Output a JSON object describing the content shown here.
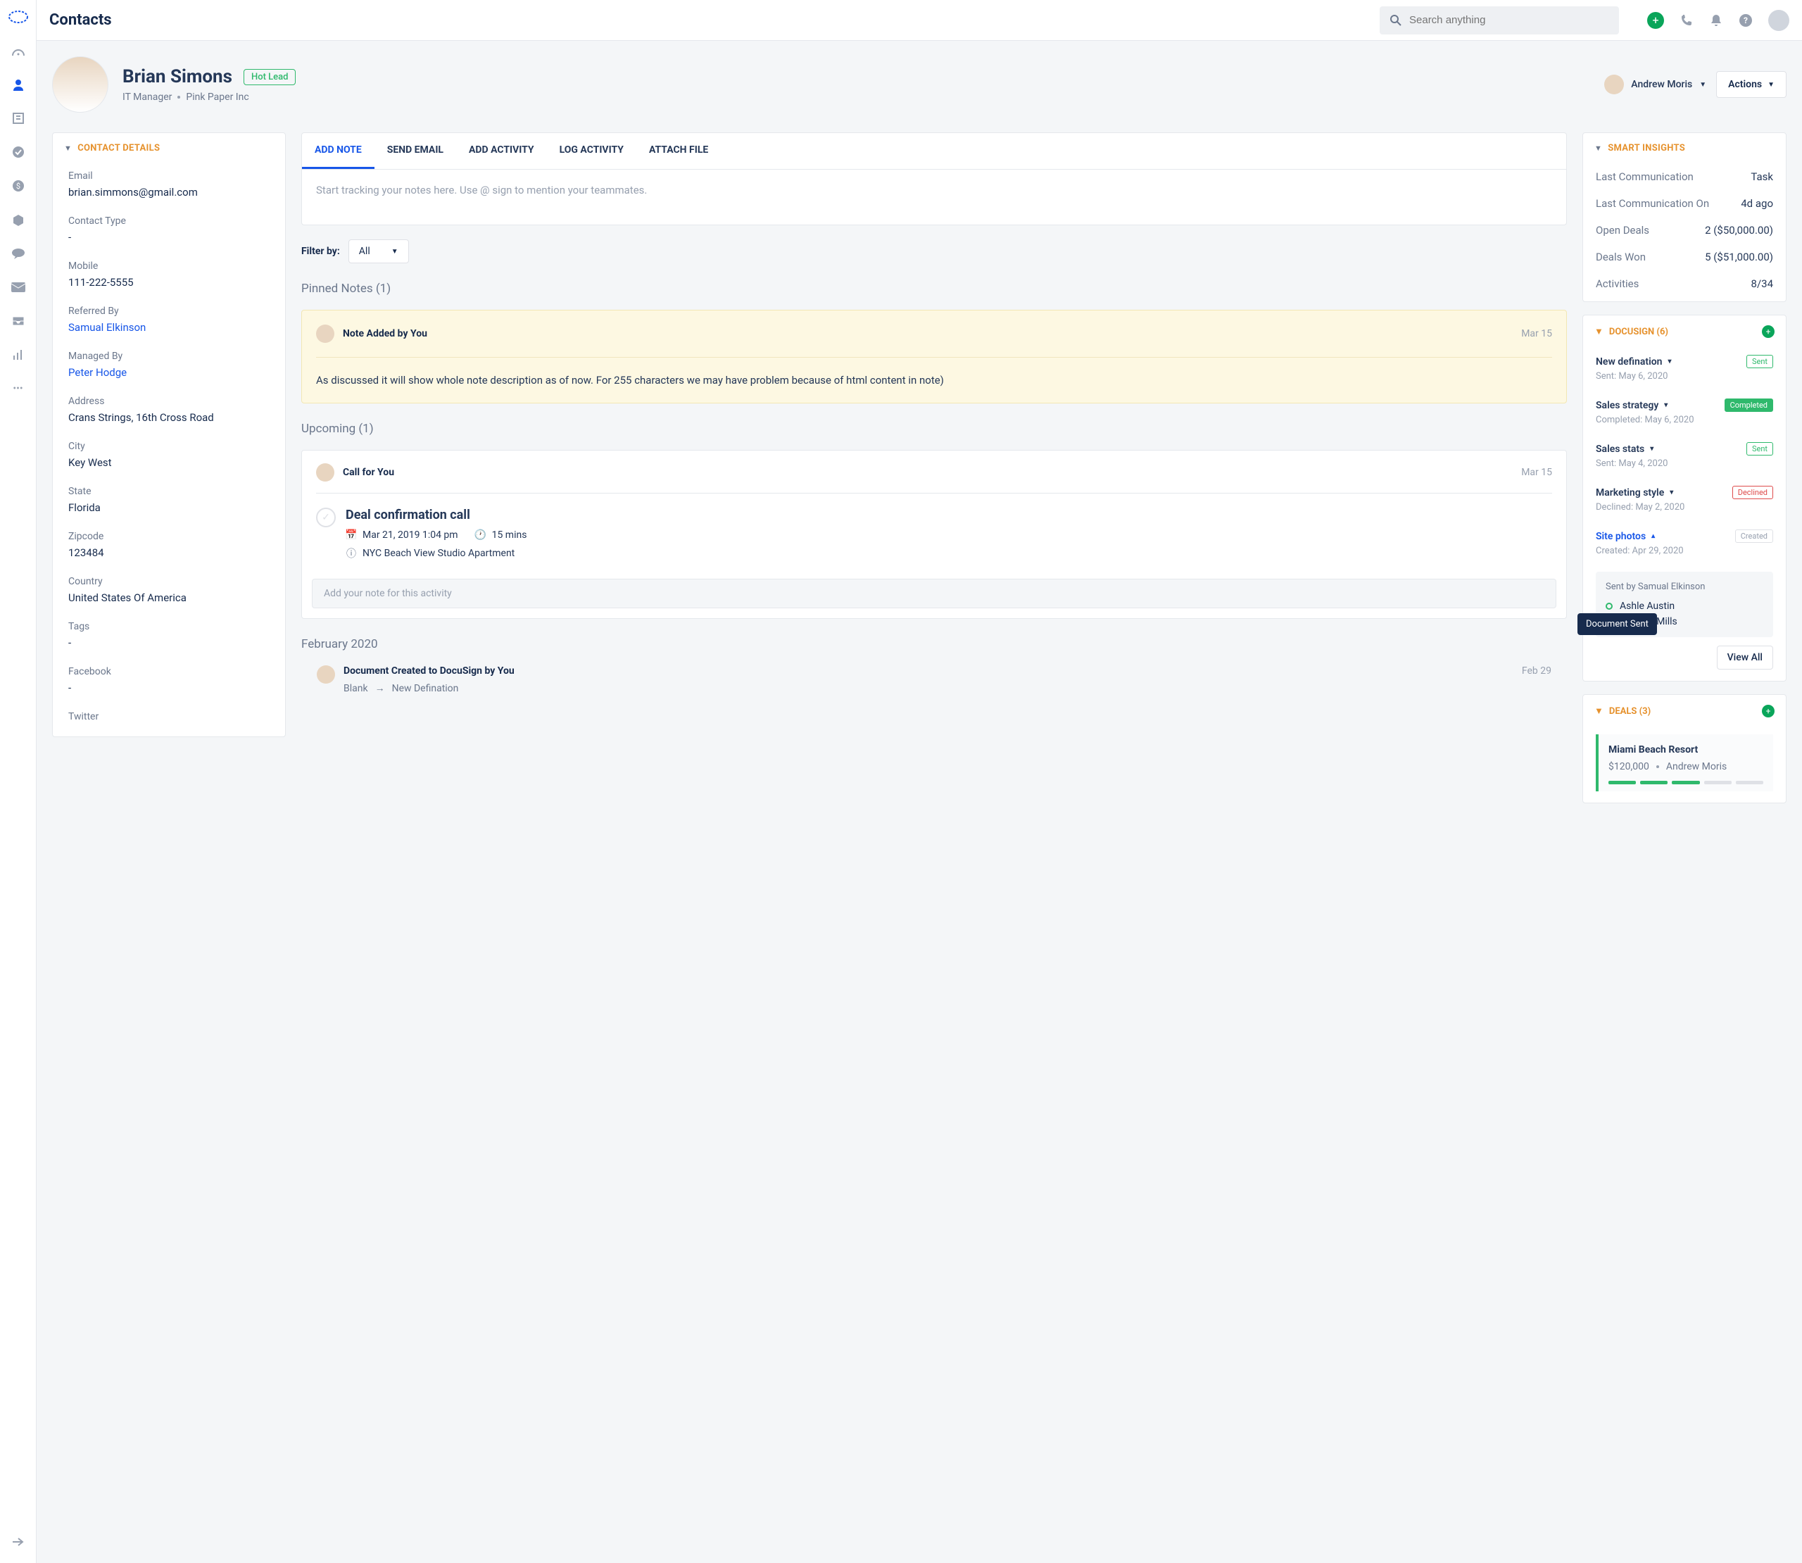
{
  "page_title": "Contacts",
  "search_placeholder": "Search anything",
  "contact": {
    "name": "Brian Simons",
    "badge": "Hot Lead",
    "role": "IT Manager",
    "company": "Pink Paper Inc"
  },
  "owner": {
    "name": "Andrew Moris"
  },
  "actions_label": "Actions",
  "details": {
    "title": "CONTACT DETAILS",
    "email_label": "Email",
    "email": "brian.simmons@gmail.com",
    "contact_type_label": "Contact Type",
    "contact_type": "-",
    "mobile_label": "Mobile",
    "mobile": "111-222-5555",
    "referred_label": "Referred By",
    "referred": "Samual Elkinson",
    "managed_label": "Managed By",
    "managed": "Peter Hodge",
    "address_label": "Address",
    "address": "Crans Strings, 16th Cross Road",
    "city_label": "City",
    "city": "Key West",
    "state_label": "State",
    "state": "Florida",
    "zip_label": "Zipcode",
    "zip": "123484",
    "country_label": "Country",
    "country": "United States Of America",
    "tags_label": "Tags",
    "tags": "-",
    "fb_label": "Facebook",
    "fb": "-",
    "tw_label": "Twitter"
  },
  "tabs": {
    "add_note": "ADD NOTE",
    "send_email": "SEND EMAIL",
    "add_activity": "ADD ACTIVITY",
    "log_activity": "LOG ACTIVITY",
    "attach_file": "ATTACH FILE"
  },
  "note_placeholder": "Start tracking your notes here. Use @ sign to mention your teammates.",
  "filter_label": "Filter by:",
  "filter_value": "All",
  "pinned_title": "Pinned Notes (1)",
  "pinned": {
    "title": "Note Added",
    "by": " by You",
    "date": "Mar 15",
    "body": "As discussed it will show whole note description as of now. For 255 characters we may have problem because of html content in note)"
  },
  "upcoming_title": "Upcoming (1)",
  "call": {
    "head": "Call",
    "by": " for You",
    "date": "Mar 15",
    "title": "Deal confirmation call",
    "datetime": "Mar 21, 2019 1:04 pm",
    "duration": "15 mins",
    "location": "NYC Beach View Studio Apartment",
    "add_note": "Add your note for this activity"
  },
  "feb_title": "February 2020",
  "feb_event": {
    "title": "Document Created to DocuSign",
    "by": " by You",
    "date": "Feb 29",
    "from": "Blank",
    "to": "New Defination"
  },
  "insights": {
    "title": "SMART INSIGHTS",
    "last_comm_k": "Last Communication",
    "last_comm_v": "Task",
    "last_comm_on_k": "Last Communication On",
    "last_comm_on_v": "4d ago",
    "open_deals_k": "Open Deals",
    "open_deals_v": "2 ($50,000.00)",
    "deals_won_k": "Deals Won",
    "deals_won_v": "5 ($51,000.00)",
    "activities_k": "Activities",
    "activities_v": "8/34"
  },
  "docusign": {
    "title": "DOCUSIGN (6)",
    "items": [
      {
        "name": "New defination",
        "sub": "Sent: May 6, 2020",
        "badge": "Sent",
        "cls": "b-sent"
      },
      {
        "name": "Sales strategy",
        "sub": "Completed: May 6, 2020",
        "badge": "Completed",
        "cls": "b-completed"
      },
      {
        "name": "Sales stats",
        "sub": "Sent: May 4, 2020",
        "badge": "Sent",
        "cls": "b-sent"
      },
      {
        "name": "Marketing style",
        "sub": "Declined: May 2, 2020",
        "badge": "Declined",
        "cls": "b-declined"
      }
    ],
    "expanded": {
      "name": "Site photos",
      "sub": "Created: Apr 29, 2020",
      "badge": "Created"
    },
    "sender": "Sent by Samual Elkinson",
    "p1": "Ashle Austin",
    "p2_suffix": "y Mills",
    "tooltip": "Document Sent",
    "view_all": "View All"
  },
  "deals": {
    "title": "DEALS (3)",
    "name": "Miami Beach Resort",
    "amount": "$120,000",
    "owner": "Andrew Moris"
  }
}
